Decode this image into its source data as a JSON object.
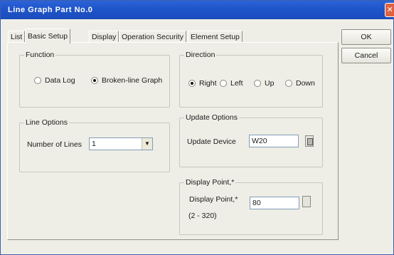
{
  "window": {
    "title": "Line Graph Part No.0",
    "close_glyph": "✕"
  },
  "tabs": [
    {
      "label": "List",
      "active": false
    },
    {
      "label": "Basic Setup",
      "active": true
    },
    {
      "label": "Display",
      "active": false
    },
    {
      "label": "Operation Security",
      "active": false
    },
    {
      "label": "Element Setup",
      "active": false
    }
  ],
  "buttons": {
    "ok": "OK",
    "cancel": "Cancel"
  },
  "function_group": {
    "title": "Function",
    "options": [
      {
        "label": "Data Log",
        "selected": false
      },
      {
        "label": "Broken-line Graph",
        "selected": true
      }
    ]
  },
  "direction_group": {
    "title": "Direction",
    "options": [
      {
        "label": "Right",
        "selected": true
      },
      {
        "label": "Left",
        "selected": false
      },
      {
        "label": "Up",
        "selected": false
      },
      {
        "label": "Down",
        "selected": false
      }
    ]
  },
  "line_options": {
    "title": "Line Options",
    "lines_label": "Number of Lines",
    "lines_value": "1"
  },
  "update_options": {
    "title": "Update Options",
    "device_label": "Update Device",
    "device_value": "W20"
  },
  "display_point": {
    "title": "Display Point,*",
    "field_label": "Display Point,*",
    "value": "80",
    "range_hint": "(2 - 320)"
  },
  "icons": {
    "dropdown": "chevron-down-icon",
    "browse": "ellipsis-icon"
  }
}
